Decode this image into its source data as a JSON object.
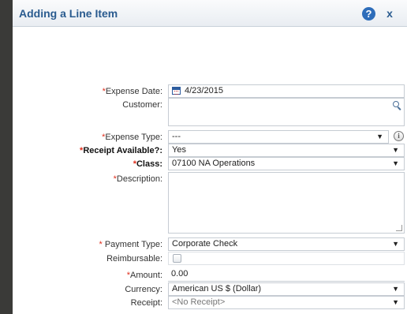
{
  "dialog": {
    "title": "Adding a Line Item",
    "help_label": "?",
    "close_label": "x"
  },
  "required_marker": "*",
  "form": {
    "expense_date": {
      "label": "Expense Date:",
      "value": "4/23/2015"
    },
    "customer": {
      "label": "Customer:",
      "value": ""
    },
    "expense_type": {
      "label": "Expense Type:",
      "value": "---"
    },
    "receipt_available": {
      "label": "Receipt Available?:",
      "value": "Yes"
    },
    "class": {
      "label": "Class:",
      "value": "07100 NA Operations"
    },
    "description": {
      "label": "Description:",
      "value": ""
    },
    "payment_type": {
      "label": "Payment Type:",
      "value": "Corporate Check"
    },
    "reimbursable": {
      "label": "Reimbursable:",
      "checked": false
    },
    "amount": {
      "label": "Amount:",
      "value": "0.00"
    },
    "currency": {
      "label": "Currency:",
      "value": "American US $ (Dollar)"
    },
    "receipt": {
      "label": "Receipt:",
      "value": "<No Receipt>"
    }
  },
  "dropdown_arrow": "▼",
  "info_glyph": "i"
}
